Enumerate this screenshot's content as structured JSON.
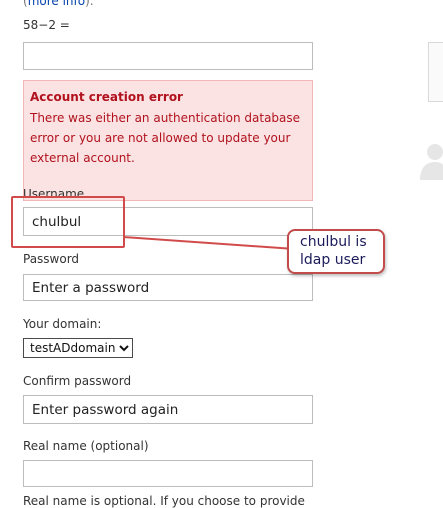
{
  "form": {
    "more_info_prefix": "(",
    "more_info_link": "more info",
    "more_info_suffix": ").",
    "captcha_question": "58−2 =",
    "captcha_value": "",
    "error": {
      "title": "Account creation error",
      "message": "There was either an authentication database error or you are not allowed to update your external account."
    },
    "username_label": "Username",
    "username_value": "chulbul",
    "password_label": "Password",
    "password_placeholder": "Enter a password",
    "domain_label": "Your domain:",
    "domain_selected": "testADdomain",
    "confirm_label": "Confirm password",
    "confirm_placeholder": "Enter password again",
    "realname_label": "Real name (optional)",
    "realname_value": "",
    "bottom_text": "Real name is optional. If you choose to provide"
  },
  "annotation": {
    "callout_line1": "chulbul is",
    "callout_line2": "ldap user",
    "color": "#d14b4b"
  },
  "colors": {
    "error_bg": "#fbe3e4",
    "error_text": "#b1121d",
    "link": "#0645ad"
  }
}
